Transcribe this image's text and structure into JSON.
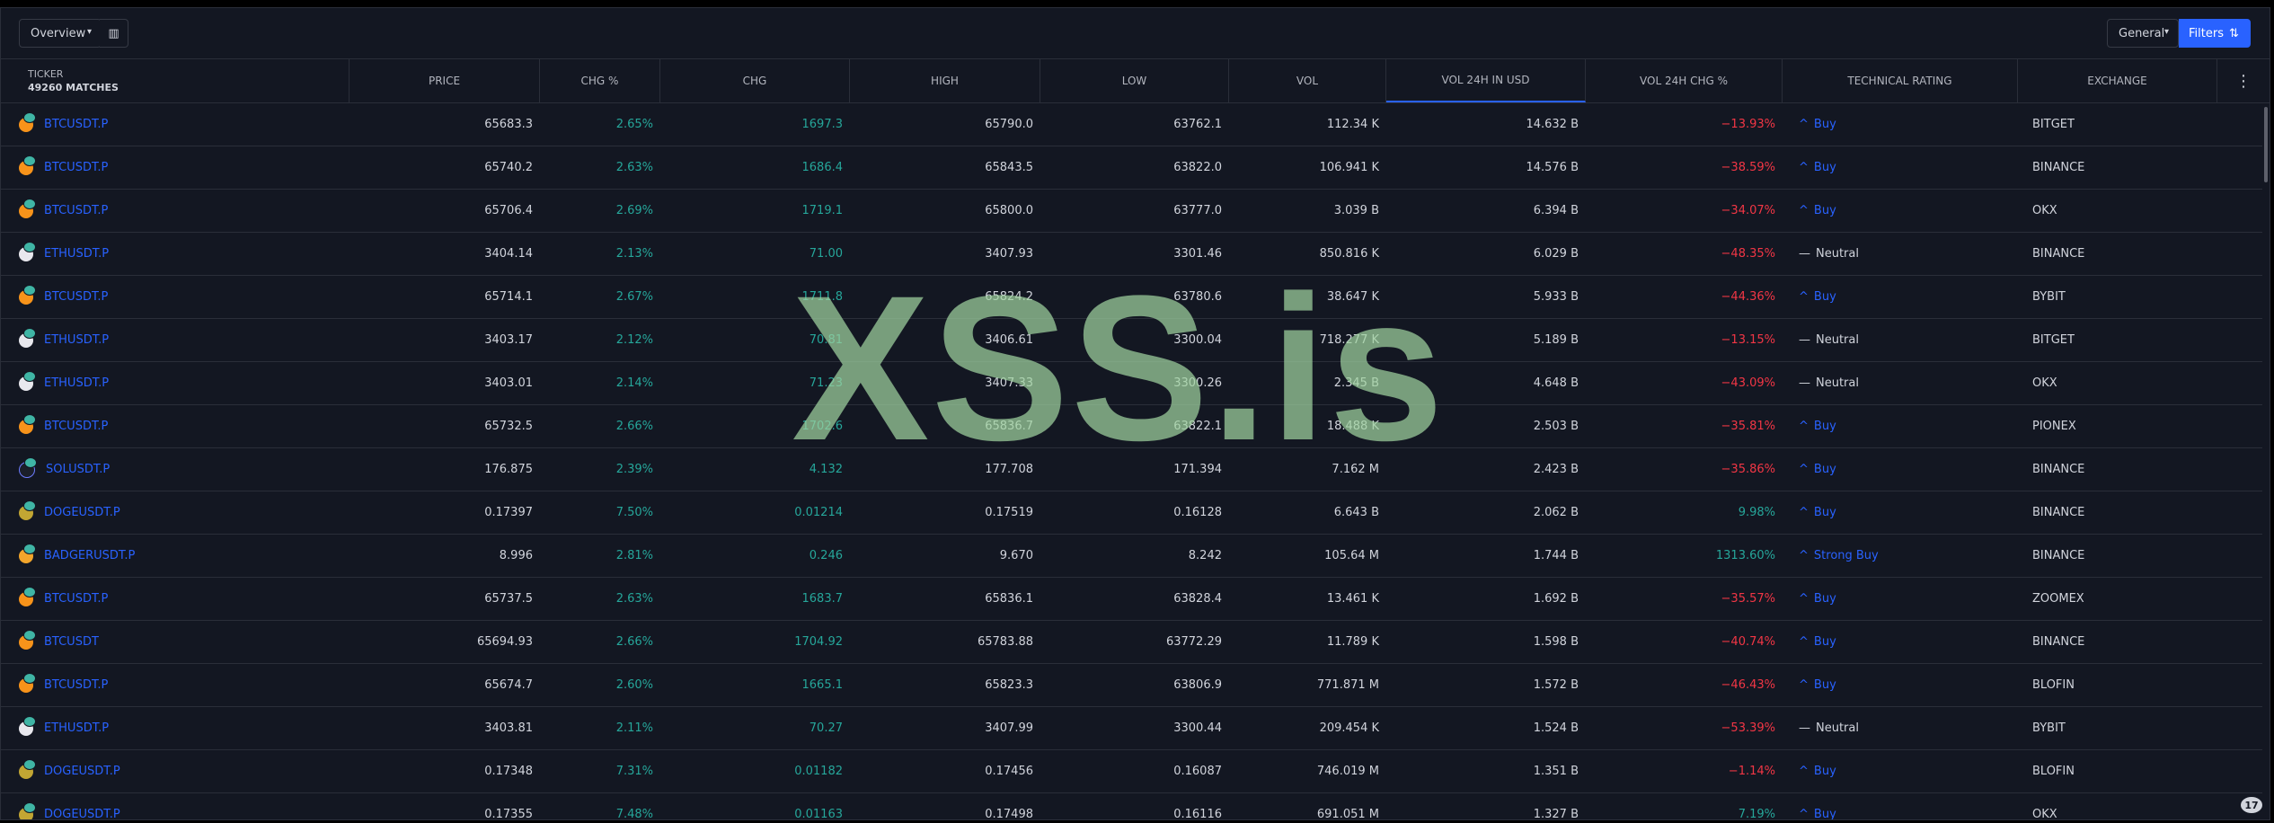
{
  "toolbar": {
    "overview_label": "Overview",
    "general_label": "General",
    "filters_label": "Filters"
  },
  "header": {
    "ticker_label": "TICKER",
    "matches_label": "49260 MATCHES",
    "columns": [
      "PRICE",
      "CHG %",
      "CHG",
      "HIGH",
      "LOW",
      "VOL",
      "VOL 24H IN USD",
      "VOL 24H CHG %",
      "TECHNICAL RATING",
      "EXCHANGE"
    ],
    "active_column": "VOL 24H IN USD"
  },
  "rows": [
    {
      "icon": "btc",
      "ticker": "BTCUSDT.P",
      "price": "65683.3",
      "chg_pct": "2.65%",
      "chg": "1697.3",
      "high": "65790.0",
      "low": "63762.1",
      "vol": "112.34 K",
      "vol_usd": "14.632 B",
      "vol_chg": "−13.93%",
      "vol_chg_sign": "neg",
      "rating_arrow": "^",
      "rating": "Buy",
      "rating_type": "buy",
      "exchange": "BITGET"
    },
    {
      "icon": "btc",
      "ticker": "BTCUSDT.P",
      "price": "65740.2",
      "chg_pct": "2.63%",
      "chg": "1686.4",
      "high": "65843.5",
      "low": "63822.0",
      "vol": "106.941 K",
      "vol_usd": "14.576 B",
      "vol_chg": "−38.59%",
      "vol_chg_sign": "neg",
      "rating_arrow": "^",
      "rating": "Buy",
      "rating_type": "buy",
      "exchange": "BINANCE"
    },
    {
      "icon": "btc",
      "ticker": "BTCUSDT.P",
      "price": "65706.4",
      "chg_pct": "2.69%",
      "chg": "1719.1",
      "high": "65800.0",
      "low": "63777.0",
      "vol": "3.039 B",
      "vol_usd": "6.394 B",
      "vol_chg": "−34.07%",
      "vol_chg_sign": "neg",
      "rating_arrow": "^",
      "rating": "Buy",
      "rating_type": "buy",
      "exchange": "OKX"
    },
    {
      "icon": "eth",
      "ticker": "ETHUSDT.P",
      "price": "3404.14",
      "chg_pct": "2.13%",
      "chg": "71.00",
      "high": "3407.93",
      "low": "3301.46",
      "vol": "850.816 K",
      "vol_usd": "6.029 B",
      "vol_chg": "−48.35%",
      "vol_chg_sign": "neg",
      "rating_arrow": "—",
      "rating": "Neutral",
      "rating_type": "neutral",
      "exchange": "BINANCE"
    },
    {
      "icon": "btc",
      "ticker": "BTCUSDT.P",
      "price": "65714.1",
      "chg_pct": "2.67%",
      "chg": "1711.8",
      "high": "65824.2",
      "low": "63780.6",
      "vol": "38.647 K",
      "vol_usd": "5.933 B",
      "vol_chg": "−44.36%",
      "vol_chg_sign": "neg",
      "rating_arrow": "^",
      "rating": "Buy",
      "rating_type": "buy",
      "exchange": "BYBIT"
    },
    {
      "icon": "eth",
      "ticker": "ETHUSDT.P",
      "price": "3403.17",
      "chg_pct": "2.12%",
      "chg": "70.81",
      "high": "3406.61",
      "low": "3300.04",
      "vol": "718.277 K",
      "vol_usd": "5.189 B",
      "vol_chg": "−13.15%",
      "vol_chg_sign": "neg",
      "rating_arrow": "—",
      "rating": "Neutral",
      "rating_type": "neutral",
      "exchange": "BITGET"
    },
    {
      "icon": "eth",
      "ticker": "ETHUSDT.P",
      "price": "3403.01",
      "chg_pct": "2.14%",
      "chg": "71.23",
      "high": "3407.33",
      "low": "3300.26",
      "vol": "2.345 B",
      "vol_usd": "4.648 B",
      "vol_chg": "−43.09%",
      "vol_chg_sign": "neg",
      "rating_arrow": "—",
      "rating": "Neutral",
      "rating_type": "neutral",
      "exchange": "OKX"
    },
    {
      "icon": "btc",
      "ticker": "BTCUSDT.P",
      "price": "65732.5",
      "chg_pct": "2.66%",
      "chg": "1702.6",
      "high": "65836.7",
      "low": "63822.1",
      "vol": "18.488 K",
      "vol_usd": "2.503 B",
      "vol_chg": "−35.81%",
      "vol_chg_sign": "neg",
      "rating_arrow": "^",
      "rating": "Buy",
      "rating_type": "buy",
      "exchange": "PIONEX"
    },
    {
      "icon": "sol",
      "ticker": "SOLUSDT.P",
      "price": "176.875",
      "chg_pct": "2.39%",
      "chg": "4.132",
      "high": "177.708",
      "low": "171.394",
      "vol": "7.162 M",
      "vol_usd": "2.423 B",
      "vol_chg": "−35.86%",
      "vol_chg_sign": "neg",
      "rating_arrow": "^",
      "rating": "Buy",
      "rating_type": "buy",
      "exchange": "BINANCE"
    },
    {
      "icon": "doge",
      "ticker": "DOGEUSDT.P",
      "price": "0.17397",
      "chg_pct": "7.50%",
      "chg": "0.01214",
      "high": "0.17519",
      "low": "0.16128",
      "vol": "6.643 B",
      "vol_usd": "2.062 B",
      "vol_chg": "9.98%",
      "vol_chg_sign": "pos",
      "rating_arrow": "^",
      "rating": "Buy",
      "rating_type": "buy",
      "exchange": "BINANCE"
    },
    {
      "icon": "badger",
      "ticker": "BADGERUSDT.P",
      "price": "8.996",
      "chg_pct": "2.81%",
      "chg": "0.246",
      "high": "9.670",
      "low": "8.242",
      "vol": "105.64 M",
      "vol_usd": "1.744 B",
      "vol_chg": "1313.60%",
      "vol_chg_sign": "pos",
      "rating_arrow": "^",
      "rating": "Strong Buy",
      "rating_type": "buy",
      "exchange": "BINANCE"
    },
    {
      "icon": "btc",
      "ticker": "BTCUSDT.P",
      "price": "65737.5",
      "chg_pct": "2.63%",
      "chg": "1683.7",
      "high": "65836.1",
      "low": "63828.4",
      "vol": "13.461 K",
      "vol_usd": "1.692 B",
      "vol_chg": "−35.57%",
      "vol_chg_sign": "neg",
      "rating_arrow": "^",
      "rating": "Buy",
      "rating_type": "buy",
      "exchange": "ZOOMEX"
    },
    {
      "icon": "btc",
      "ticker": "BTCUSDT",
      "price": "65694.93",
      "chg_pct": "2.66%",
      "chg": "1704.92",
      "high": "65783.88",
      "low": "63772.29",
      "vol": "11.789 K",
      "vol_usd": "1.598 B",
      "vol_chg": "−40.74%",
      "vol_chg_sign": "neg",
      "rating_arrow": "^",
      "rating": "Buy",
      "rating_type": "buy",
      "exchange": "BINANCE"
    },
    {
      "icon": "btc",
      "ticker": "BTCUSDT.P",
      "price": "65674.7",
      "chg_pct": "2.60%",
      "chg": "1665.1",
      "high": "65823.3",
      "low": "63806.9",
      "vol": "771.871 M",
      "vol_usd": "1.572 B",
      "vol_chg": "−46.43%",
      "vol_chg_sign": "neg",
      "rating_arrow": "^",
      "rating": "Buy",
      "rating_type": "buy",
      "exchange": "BLOFIN"
    },
    {
      "icon": "eth",
      "ticker": "ETHUSDT.P",
      "price": "3403.81",
      "chg_pct": "2.11%",
      "chg": "70.27",
      "high": "3407.99",
      "low": "3300.44",
      "vol": "209.454 K",
      "vol_usd": "1.524 B",
      "vol_chg": "−53.39%",
      "vol_chg_sign": "neg",
      "rating_arrow": "—",
      "rating": "Neutral",
      "rating_type": "neutral",
      "exchange": "BYBIT"
    },
    {
      "icon": "doge",
      "ticker": "DOGEUSDT.P",
      "price": "0.17348",
      "chg_pct": "7.31%",
      "chg": "0.01182",
      "high": "0.17456",
      "low": "0.16087",
      "vol": "746.019 M",
      "vol_usd": "1.351 B",
      "vol_chg": "−1.14%",
      "vol_chg_sign": "neg",
      "rating_arrow": "^",
      "rating": "Buy",
      "rating_type": "buy",
      "exchange": "BLOFIN"
    },
    {
      "icon": "doge",
      "ticker": "DOGEUSDT.P",
      "price": "0.17355",
      "chg_pct": "7.48%",
      "chg": "0.01163",
      "high": "0.17498",
      "low": "0.16116",
      "vol": "691.051 M",
      "vol_usd": "1.327 B",
      "vol_chg": "7.19%",
      "vol_chg_sign": "pos",
      "rating_arrow": "^",
      "rating": "Buy",
      "rating_type": "buy",
      "exchange": "OKX"
    }
  ],
  "watermark_text": "XSS.is",
  "logo_text": "17",
  "colors": {
    "background": "#131722",
    "accent": "#2962ff",
    "positive": "#26a69a",
    "negative": "#f23645",
    "text": "#d1d4dc"
  },
  "icons": {
    "columns_toggle": "columns-icon",
    "filters": "filter-sort-icon",
    "more": "vertical-dots-icon"
  }
}
